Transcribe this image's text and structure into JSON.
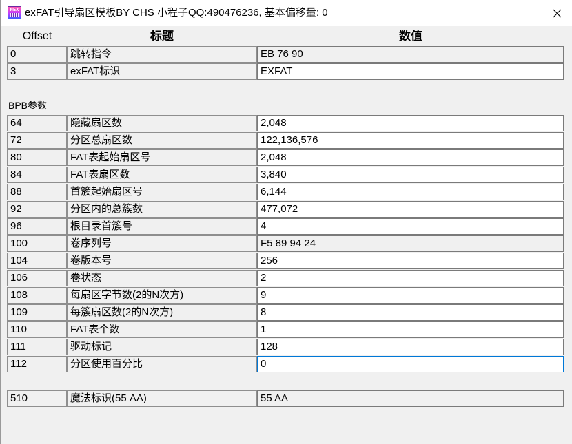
{
  "window": {
    "title": "exFAT引导扇区模板BY CHS 小程子QQ:490476236, 基本偏移量: 0",
    "icon_text": "HEX"
  },
  "headers": {
    "offset": "Offset",
    "title": "标题",
    "value": "数值"
  },
  "section_bpb": "BPB参数",
  "rows_top": [
    {
      "offset": "0",
      "title": "跳转指令",
      "value": "EB 76 90",
      "editable": false
    },
    {
      "offset": "3",
      "title": "exFAT标识",
      "value": "EXFAT",
      "editable": true
    }
  ],
  "rows_bpb": [
    {
      "offset": "64",
      "title": "隐藏扇区数",
      "value": "2,048"
    },
    {
      "offset": "72",
      "title": "分区总扇区数",
      "value": "122,136,576"
    },
    {
      "offset": "80",
      "title": "FAT表起始扇区号",
      "value": "2,048"
    },
    {
      "offset": "84",
      "title": "FAT表扇区数",
      "value": "3,840"
    },
    {
      "offset": "88",
      "title": "首簇起始扇区号",
      "value": "6,144"
    },
    {
      "offset": "92",
      "title": "分区内的总簇数",
      "value": "477,072"
    },
    {
      "offset": "96",
      "title": "根目录首簇号",
      "value": "4"
    },
    {
      "offset": "100",
      "title": "卷序列号",
      "value": "F5 89 94 24"
    },
    {
      "offset": "104",
      "title": "卷版本号",
      "value": "256"
    },
    {
      "offset": "106",
      "title": "卷状态",
      "value": "2"
    },
    {
      "offset": "108",
      "title": "每扇区字节数(2的N次方)",
      "value": "9"
    },
    {
      "offset": "109",
      "title": "每簇扇区数(2的N次方)",
      "value": "8"
    },
    {
      "offset": "110",
      "title": "FAT表个数",
      "value": "1"
    },
    {
      "offset": "111",
      "title": "驱动标记",
      "value": "128"
    },
    {
      "offset": "112",
      "title": "分区使用百分比",
      "value": "0"
    }
  ],
  "row_magic": {
    "offset": "510",
    "title": "魔法标识(55 AA)",
    "value": "55 AA"
  }
}
